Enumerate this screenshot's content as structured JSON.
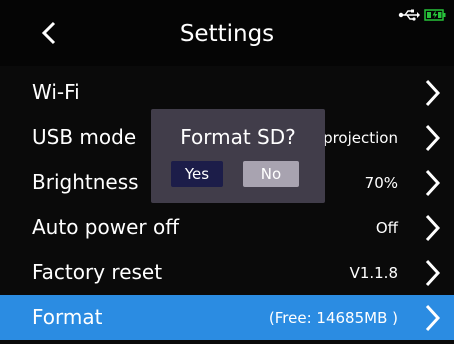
{
  "header": {
    "title": "Settings",
    "back_icon": "chevron-left-icon",
    "status_icons": [
      "usb-icon",
      "battery-charging-icon"
    ],
    "battery_color": "#27c33a"
  },
  "settings": [
    {
      "label": "Wi-Fi",
      "value": ""
    },
    {
      "label": "USB mode",
      "value": "projection"
    },
    {
      "label": "Brightness",
      "value": "70%"
    },
    {
      "label": "Auto power off",
      "value": "Off"
    },
    {
      "label": "Factory reset",
      "value": "V1.1.8"
    },
    {
      "label": "Format",
      "value": "(Free: 14685MB )"
    }
  ],
  "selected_index": 5,
  "accent_color": "#2b8ce2",
  "dialog": {
    "title": "Format SD?",
    "yes_label": "Yes",
    "no_label": "No"
  }
}
